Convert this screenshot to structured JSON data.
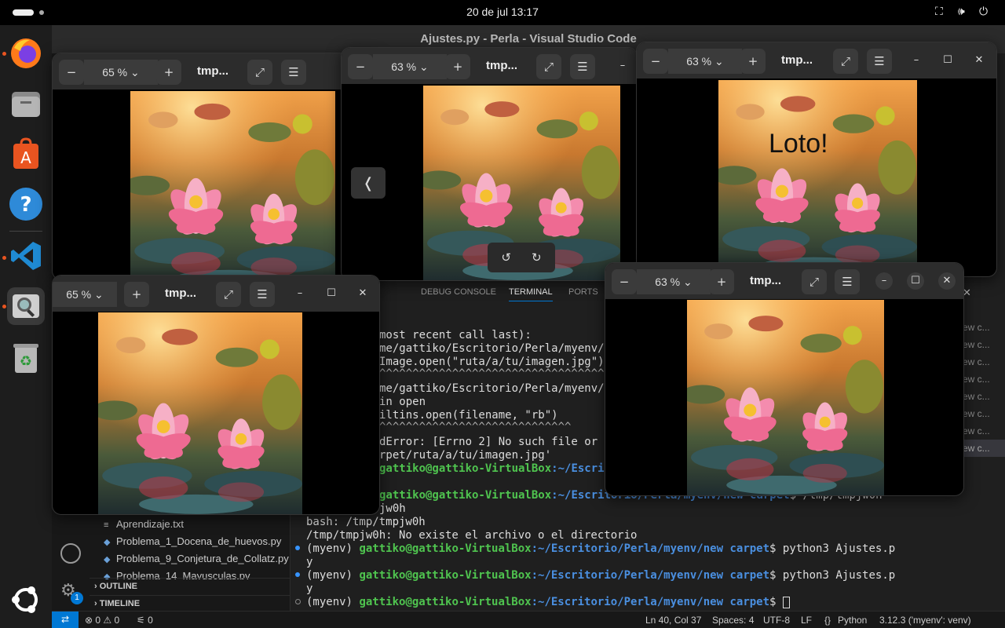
{
  "topbar": {
    "clock": "20 de jul  13:17",
    "icons": [
      "network-icon",
      "volume-icon",
      "power-icon"
    ]
  },
  "dock": {
    "items": [
      "firefox-icon",
      "files-icon",
      "app-center-icon",
      "help-icon",
      "vscode-icon",
      "image-viewer-icon",
      "trash-icon",
      "show-apps-icon"
    ]
  },
  "vscode": {
    "title": "Ajustes.py - Perla - Visual Studio Code",
    "files": [
      "Aprendizaje.txt",
      "Problema_1_Docena_de_huevos.py",
      "Problema_9_Conjetura_de_Collatz.py",
      "Problema_14_Mayusculas.py"
    ],
    "sections": [
      "OUTLINE",
      "TIMELINE"
    ],
    "panel_tabs": [
      "DEBUG CONSOLE",
      "TERMINAL",
      "PORTS"
    ],
    "terminal_lines": [
      "most recent call last):",
      "me/gattiko/Escritorio/Perla/myenv/",
      "Image.open(\"ruta/a/tu/imagen.jpg\")",
      "^^^^^^^^^^^^^^^^^^^^^^^^^^^^^^^^^^^",
      "me/gattiko/Escritorio/Perla/myenv/",
      "in open",
      "iltins.open(filename, \"rb\")",
      "^^^^^^^^^^^^^^^^^^^^^^^^^^^^^",
      "dError: [Errno 2] No such file or",
      "rpet/ruta/a/tu/imagen.jpg'"
    ],
    "prompt_user": "gattiko@gattiko-VirtualBox",
    "prompt_path_short": ":~/Escritor",
    "prompt_path": ":~/Escritorio/Perla/myenv/new carpet",
    "prompt_cmd_partial": "$ /tmp/tmpjw0h",
    "line_jw0h": "jw0h",
    "line_bash": "bash: /tmp/tmpjw0h",
    "line_noexist": "/tmp/tmpjw0h: No existe el archivo o el directorio",
    "env": "(myenv) ",
    "cmd_ajustes": "$ python3 Ajustes.p",
    "wrap_y": "y",
    "cmd_end": "$ ",
    "right_list": [
      "ew c...",
      "ew c...",
      "ew c...",
      "ew c...",
      "ew c...",
      "ew c...",
      "ew c...",
      "ew c..."
    ],
    "status": {
      "errors": "⊗ 0 ⚠ 0",
      "ports": "⚟ 0",
      "position": "Ln 40, Col 37",
      "spaces": "Spaces: 4",
      "encoding": "UTF-8",
      "eol": "LF",
      "language": "Python",
      "interpreter": "3.12.3 ('myenv': venv)",
      "notification_count": "1"
    }
  },
  "viewers": [
    {
      "zoom": "65 %",
      "title": "tmp..."
    },
    {
      "zoom": "63 %",
      "title": "tmp..."
    },
    {
      "zoom": "63 %",
      "title": "tmp...",
      "overlay_text": "Loto!"
    },
    {
      "zoom": "65 %",
      "title": "tmp..."
    },
    {
      "zoom": "63 %",
      "title": "tmp..."
    }
  ]
}
